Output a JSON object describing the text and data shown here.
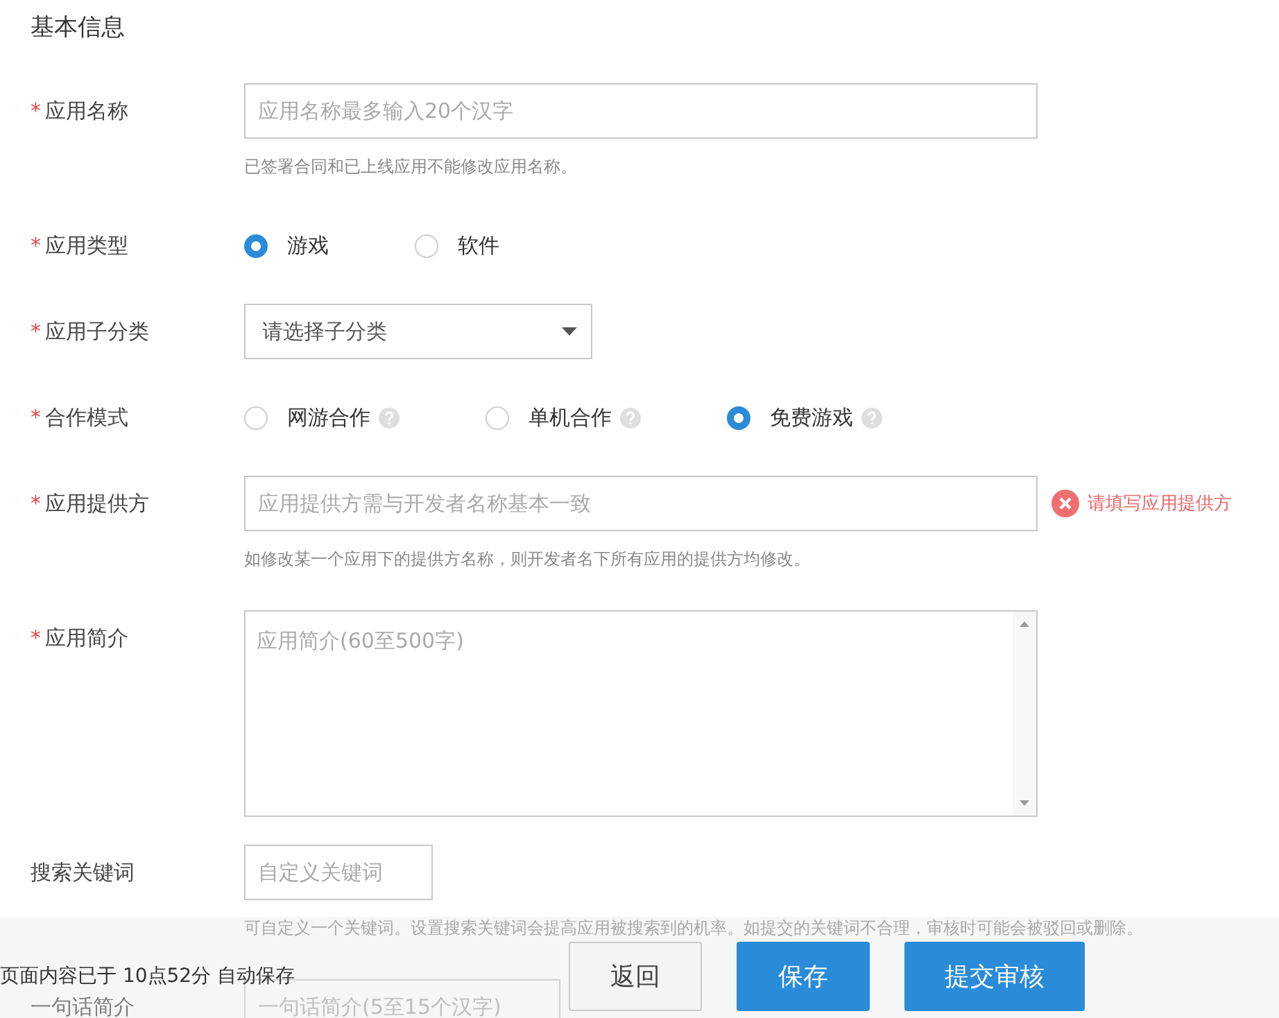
{
  "section_title": "基本信息",
  "fields": [
    {
      "kind": "text",
      "mark": "*",
      "label": "应用名称",
      "placeholder": "应用名称最多输入20个汉字",
      "hint": "已签署合同和已上线应用不能修改应用名称。"
    },
    {
      "kind": "radio",
      "mark": "*",
      "label": "应用类型",
      "options": [
        {
          "label": "游戏",
          "selected": true,
          "help": false
        },
        {
          "label": "软件",
          "selected": false,
          "help": false
        }
      ]
    },
    {
      "kind": "select",
      "mark": "*",
      "label": "应用子分类",
      "value": "请选择子分类"
    },
    {
      "kind": "radio",
      "mark": "*",
      "label": "合作模式",
      "options": [
        {
          "label": "网游合作",
          "selected": false,
          "help": true
        },
        {
          "label": "单机合作",
          "selected": false,
          "help": true
        },
        {
          "label": "免费游戏",
          "selected": true,
          "help": true
        }
      ]
    },
    {
      "kind": "text",
      "mark": "*",
      "label": "应用提供方",
      "placeholder": "应用提供方需与开发者名称基本一致",
      "error": "请填写应用提供方",
      "hint": "如修改某一个应用下的提供方名称，则开发者名下所有应用的提供方均修改。"
    },
    {
      "kind": "textarea",
      "mark": "*",
      "label": "应用简介",
      "placeholder": "应用简介(60至500字)"
    },
    {
      "kind": "short",
      "label": "搜索关键词",
      "placeholder": "自定义关键词",
      "hint": "可自定义一个关键词。设置搜索关键词会提高应用被搜索到的机率。如提交的关键词不合理，审核时可能会被驳回或删除。"
    },
    {
      "kind": "covered",
      "label": "一句话简介",
      "placeholder": "一句话简介(5至15个汉字)"
    }
  ],
  "footer": {
    "autosave": "页面内容已于 10点52分 自动保存",
    "buttons": [
      {
        "label": "返回",
        "kind": "secondary"
      },
      {
        "label": "保存",
        "kind": "primary"
      },
      {
        "label": "提交审核",
        "kind": "primary"
      }
    ]
  }
}
